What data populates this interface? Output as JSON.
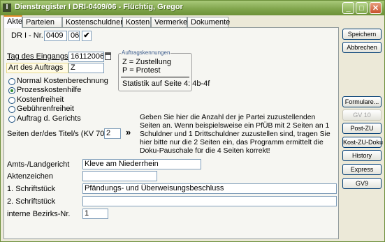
{
  "window": {
    "title": "Dienstregister I DRI-0409/06 - Flüchtig, Gregor",
    "app_icon": "I"
  },
  "titlebar_buttons": {
    "minimize": "_",
    "maximize": "□",
    "close": "✕"
  },
  "tabs": [
    {
      "label": "Akte",
      "active": true
    },
    {
      "label": "Parteien"
    },
    {
      "label": "Kostenschuldner"
    },
    {
      "label": "Kosten"
    },
    {
      "label": "Vermerke"
    },
    {
      "label": "Dokumente"
    }
  ],
  "form": {
    "dr_label": "DR I - Nr.",
    "dr_number": "0409",
    "dr_year": "06",
    "dr_check": "✔",
    "eingang_label": "Tag des Eingangs",
    "eingang_value": "16112006",
    "auftrag_label": "Art des Auftrags",
    "auftrag_value": "Z",
    "radios": [
      {
        "label": "Normal Kostenberechnung",
        "selected": false
      },
      {
        "label": "Prozesskostenhilfe",
        "selected": true
      },
      {
        "label": "Kostenfreiheit",
        "selected": false
      },
      {
        "label": "Gebührenfreiheit",
        "selected": false
      },
      {
        "label": "Auftrag d. Gerichts",
        "selected": false
      }
    ],
    "seiten_label": "Seiten der/des Titel/s (KV 700)",
    "seiten_value": "2",
    "seiten_arrow": "»",
    "help_text": "Geben Sie hier die Anzahl der je Partei zuzustellenden Seiten an. Wenn beispielsweise ein PfÜB mit 2 Seiten an 1 Schuldner und 1 Drittschuldner zuzustellen sind, tragen Sie hier bitte nur die 2 Seiten ein, das Programm ermittelt die Doku-Pauschale für die 4 Seiten korrekt!",
    "amtsgericht_label": "Amts-/Landgericht",
    "amtsgericht_value": "Kleve am Niederrhein",
    "aktenzeichen_label": "Aktenzeichen",
    "aktenzeichen_value": "",
    "schriftstueck1_label": "1. Schriftstück",
    "schriftstueck1_value": "Pfändungs- und Überweisungsbeschluss",
    "schriftstueck2_label": "2. Schriftstück",
    "schriftstueck2_value": "",
    "bezirk_label": "interne Bezirks-Nr.",
    "bezirk_value": "1"
  },
  "auftragskennungen": {
    "title": "Auftragskennungen",
    "line1": "Z = Zustellung",
    "line2": "P = Protest",
    "stat": "Statistik auf Seite 4: 4b-4f"
  },
  "side_buttons": {
    "speichern": "Speichern",
    "abbrechen": "Abbrechen",
    "formulare": "Formulare...",
    "gv10": "GV 10",
    "postzu": "Post-ZU",
    "kostzu": "Kost-ZU-Doku",
    "history": "History",
    "express": "Express",
    "gv9": "GV9"
  },
  "colors": {
    "titlebar": "#7ea34a",
    "tab_accent": "#e68b2c",
    "radio_dot": "#2a8a2a"
  }
}
